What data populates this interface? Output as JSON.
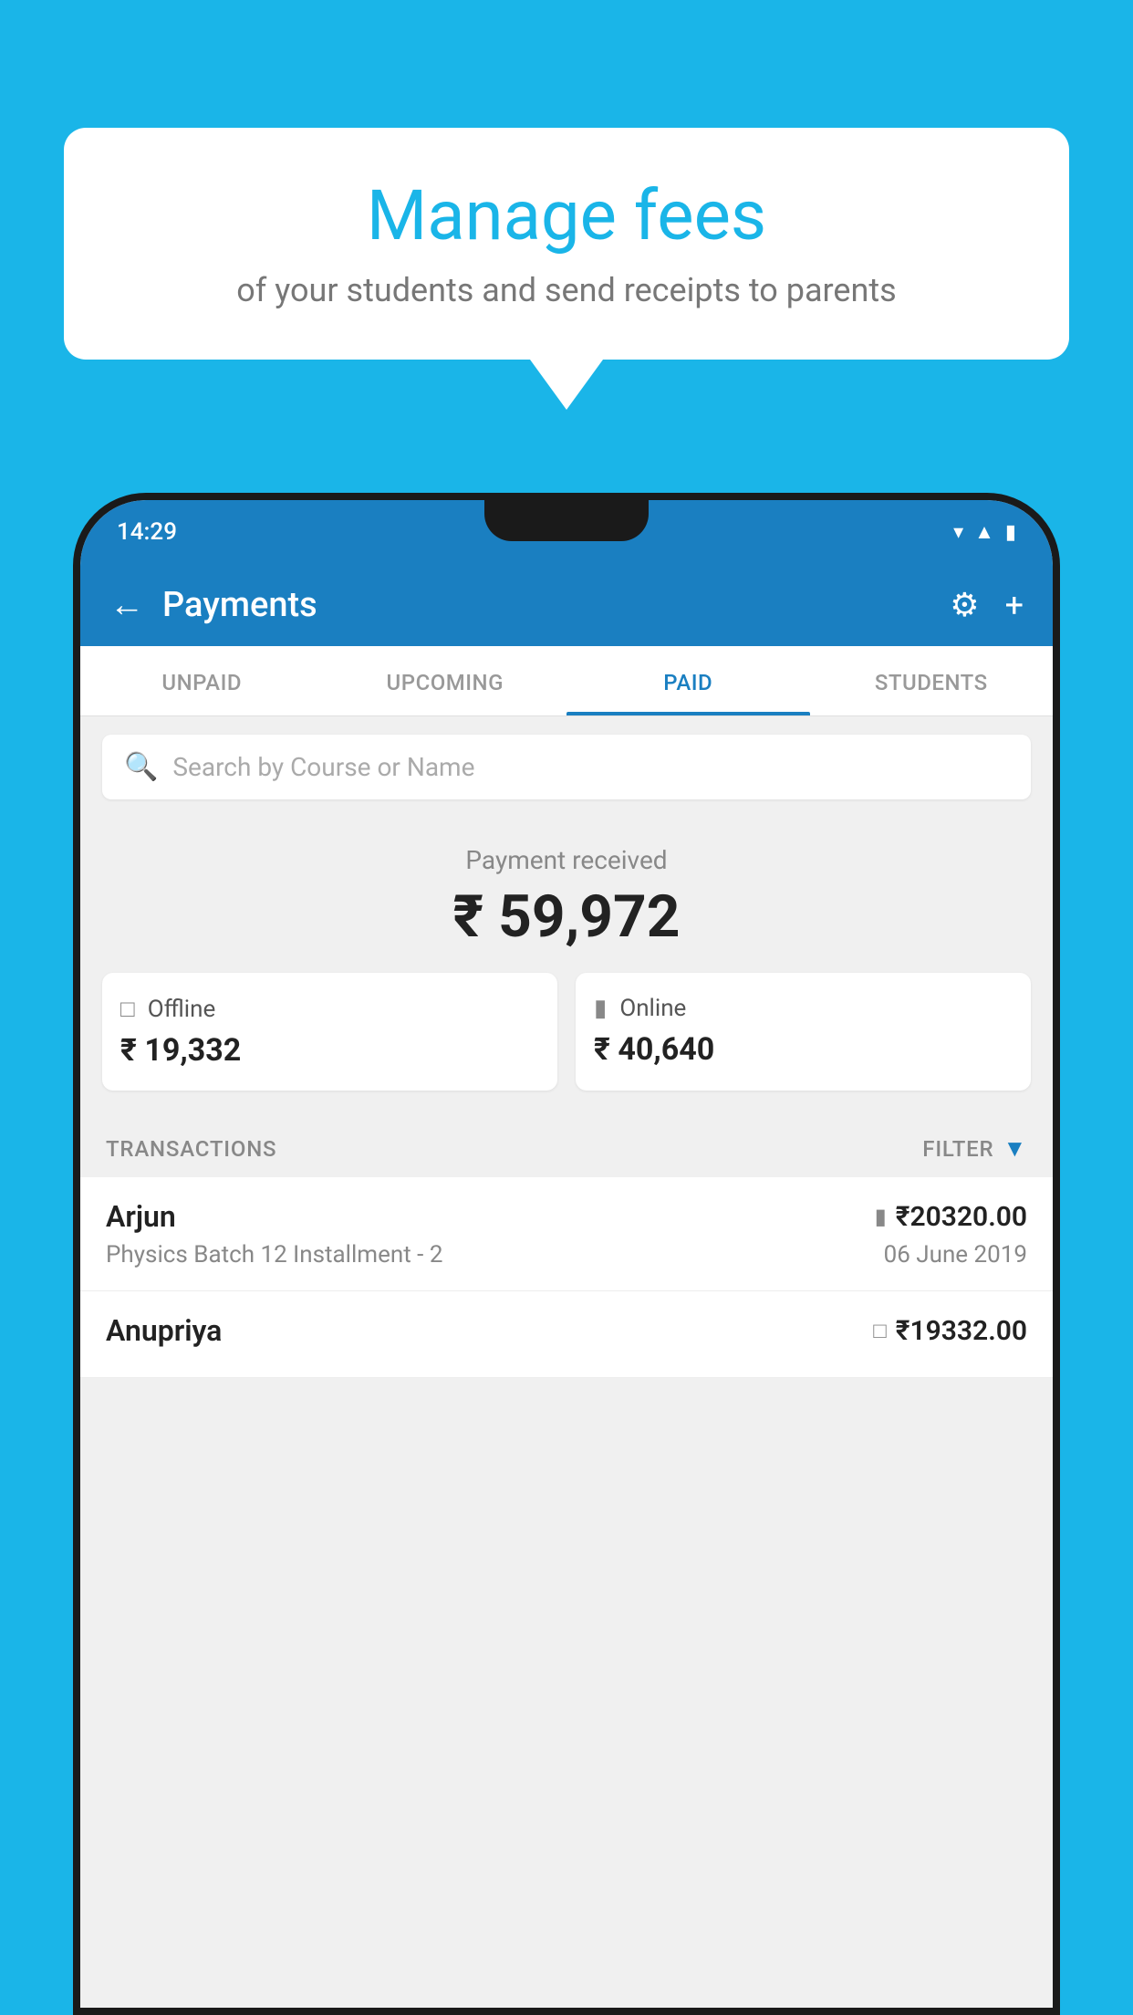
{
  "background_color": "#1ab5e8",
  "speech_bubble": {
    "title": "Manage fees",
    "subtitle": "of your students and send receipts to parents"
  },
  "phone": {
    "status_bar": {
      "time": "14:29",
      "icons": [
        "wifi",
        "signal",
        "battery"
      ]
    },
    "header": {
      "title": "Payments",
      "back_label": "←",
      "settings_icon": "⚙",
      "add_icon": "+"
    },
    "tabs": [
      {
        "label": "UNPAID",
        "active": false
      },
      {
        "label": "UPCOMING",
        "active": false
      },
      {
        "label": "PAID",
        "active": true
      },
      {
        "label": "STUDENTS",
        "active": false
      }
    ],
    "search": {
      "placeholder": "Search by Course or Name"
    },
    "payment_received": {
      "label": "Payment received",
      "total": "₹ 59,972",
      "offline": {
        "type": "Offline",
        "amount": "₹ 19,332"
      },
      "online": {
        "type": "Online",
        "amount": "₹ 40,640"
      }
    },
    "transactions": {
      "header_label": "TRANSACTIONS",
      "filter_label": "FILTER",
      "rows": [
        {
          "name": "Arjun",
          "amount": "₹20320.00",
          "course": "Physics Batch 12 Installment - 2",
          "date": "06 June 2019",
          "payment_type": "card"
        },
        {
          "name": "Anupriya",
          "amount": "₹19332.00",
          "course": "",
          "date": "",
          "payment_type": "offline"
        }
      ]
    }
  }
}
